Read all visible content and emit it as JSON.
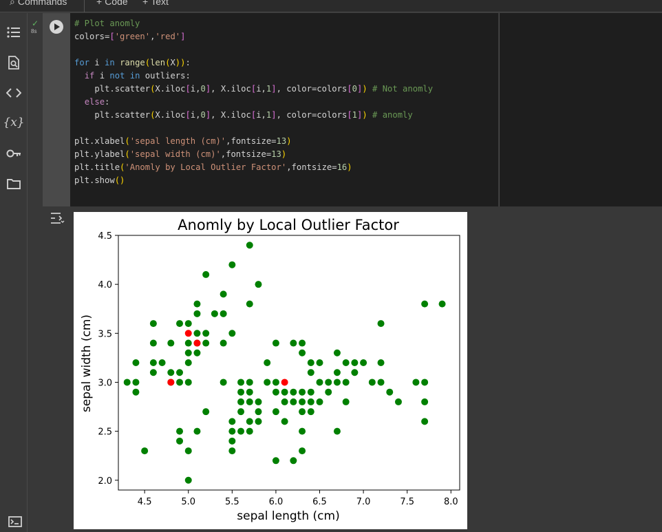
{
  "toolbar": {
    "commands_label": "Commands",
    "code_label": "Code",
    "text_label": "Text"
  },
  "sidebar": {
    "items": [
      "table-of-contents-icon",
      "find-replace-icon",
      "code-snippets-icon",
      "variables-icon",
      "secrets-key-icon",
      "files-folder-icon"
    ],
    "bottom_item": "terminal-icon"
  },
  "cell": {
    "exec_time": "8s",
    "code_lines": [
      "# Plot anomly",
      "colors=['green','red']",
      "",
      "for i in range(len(X)):",
      "  if i not in outliers:",
      "    plt.scatter(X.iloc[i,0], X.iloc[i,1], color=colors[0]) # Not anomly",
      "  else:",
      "    plt.scatter(X.iloc[i,0], X.iloc[i,1], color=colors[1]) # anomly",
      "",
      "plt.xlabel('sepal length (cm)',fontsize=13)",
      "plt.ylabel('sepal width (cm)',fontsize=13)",
      "plt.title('Anomly by Local Outlier Factor',fontsize=16)",
      "plt.show()"
    ]
  },
  "chart_data": {
    "type": "scatter",
    "title": "Anomly by Local Outlier Factor",
    "xlabel": "sepal length (cm)",
    "ylabel": "sepal width (cm)",
    "xlim": [
      4.2,
      8.1
    ],
    "ylim": [
      1.9,
      4.5
    ],
    "xticks": [
      "4.5",
      "5.0",
      "5.5",
      "6.0",
      "6.5",
      "7.0",
      "7.5",
      "8.0"
    ],
    "yticks": [
      "2.0",
      "2.5",
      "3.0",
      "3.5",
      "4.0",
      "4.5"
    ],
    "grid": false,
    "series": [
      {
        "color": "#008000",
        "points": [
          [
            4.3,
            3.0
          ],
          [
            4.4,
            2.9
          ],
          [
            4.4,
            3.0
          ],
          [
            4.4,
            3.2
          ],
          [
            4.5,
            2.3
          ],
          [
            4.6,
            3.1
          ],
          [
            4.6,
            3.2
          ],
          [
            4.6,
            3.4
          ],
          [
            4.6,
            3.6
          ],
          [
            4.7,
            3.2
          ],
          [
            4.8,
            3.0
          ],
          [
            4.8,
            3.1
          ],
          [
            4.8,
            3.4
          ],
          [
            4.9,
            2.4
          ],
          [
            4.9,
            2.5
          ],
          [
            4.9,
            3.0
          ],
          [
            4.9,
            3.1
          ],
          [
            4.9,
            3.6
          ],
          [
            5.0,
            2.0
          ],
          [
            5.0,
            2.3
          ],
          [
            5.0,
            3.0
          ],
          [
            5.0,
            3.2
          ],
          [
            5.0,
            3.3
          ],
          [
            5.0,
            3.4
          ],
          [
            5.0,
            3.6
          ],
          [
            5.1,
            2.5
          ],
          [
            5.1,
            3.3
          ],
          [
            5.1,
            3.4
          ],
          [
            5.1,
            3.5
          ],
          [
            5.1,
            3.7
          ],
          [
            5.1,
            3.8
          ],
          [
            5.2,
            2.7
          ],
          [
            5.2,
            3.4
          ],
          [
            5.2,
            3.5
          ],
          [
            5.2,
            4.1
          ],
          [
            5.3,
            3.7
          ],
          [
            5.4,
            3.0
          ],
          [
            5.4,
            3.4
          ],
          [
            5.4,
            3.7
          ],
          [
            5.4,
            3.9
          ],
          [
            5.5,
            2.3
          ],
          [
            5.5,
            2.4
          ],
          [
            5.5,
            2.5
          ],
          [
            5.5,
            2.6
          ],
          [
            5.5,
            3.5
          ],
          [
            5.5,
            4.2
          ],
          [
            5.6,
            2.5
          ],
          [
            5.6,
            2.7
          ],
          [
            5.6,
            2.8
          ],
          [
            5.6,
            2.9
          ],
          [
            5.6,
            3.0
          ],
          [
            5.7,
            2.5
          ],
          [
            5.7,
            2.6
          ],
          [
            5.7,
            2.8
          ],
          [
            5.7,
            2.9
          ],
          [
            5.7,
            3.0
          ],
          [
            5.7,
            3.8
          ],
          [
            5.7,
            4.4
          ],
          [
            5.8,
            2.6
          ],
          [
            5.8,
            2.7
          ],
          [
            5.8,
            2.8
          ],
          [
            5.8,
            4.0
          ],
          [
            5.9,
            3.0
          ],
          [
            5.9,
            3.2
          ],
          [
            6.0,
            2.2
          ],
          [
            6.0,
            2.7
          ],
          [
            6.0,
            2.9
          ],
          [
            6.0,
            3.0
          ],
          [
            6.0,
            3.4
          ],
          [
            6.1,
            2.6
          ],
          [
            6.1,
            2.8
          ],
          [
            6.1,
            2.9
          ],
          [
            6.2,
            2.2
          ],
          [
            6.2,
            2.8
          ],
          [
            6.2,
            2.9
          ],
          [
            6.2,
            3.4
          ],
          [
            6.3,
            2.3
          ],
          [
            6.3,
            2.5
          ],
          [
            6.3,
            2.7
          ],
          [
            6.3,
            2.8
          ],
          [
            6.3,
            2.9
          ],
          [
            6.3,
            3.3
          ],
          [
            6.3,
            3.4
          ],
          [
            6.4,
            2.7
          ],
          [
            6.4,
            2.8
          ],
          [
            6.4,
            2.9
          ],
          [
            6.4,
            3.1
          ],
          [
            6.4,
            3.2
          ],
          [
            6.5,
            2.8
          ],
          [
            6.5,
            3.0
          ],
          [
            6.5,
            3.2
          ],
          [
            6.6,
            2.9
          ],
          [
            6.6,
            3.0
          ],
          [
            6.7,
            2.5
          ],
          [
            6.7,
            3.0
          ],
          [
            6.7,
            3.1
          ],
          [
            6.7,
            3.3
          ],
          [
            6.8,
            2.8
          ],
          [
            6.8,
            3.0
          ],
          [
            6.8,
            3.2
          ],
          [
            6.9,
            3.1
          ],
          [
            6.9,
            3.2
          ],
          [
            7.0,
            3.2
          ],
          [
            7.1,
            3.0
          ],
          [
            7.2,
            3.0
          ],
          [
            7.2,
            3.2
          ],
          [
            7.2,
            3.6
          ],
          [
            7.3,
            2.9
          ],
          [
            7.4,
            2.8
          ],
          [
            7.6,
            3.0
          ],
          [
            7.7,
            2.6
          ],
          [
            7.7,
            2.8
          ],
          [
            7.7,
            3.0
          ],
          [
            7.7,
            3.8
          ],
          [
            7.9,
            3.8
          ]
        ]
      },
      {
        "color": "#ff0000",
        "points": [
          [
            4.8,
            3.0
          ],
          [
            5.0,
            3.5
          ],
          [
            5.1,
            3.4
          ],
          [
            6.1,
            3.0
          ]
        ]
      }
    ]
  }
}
